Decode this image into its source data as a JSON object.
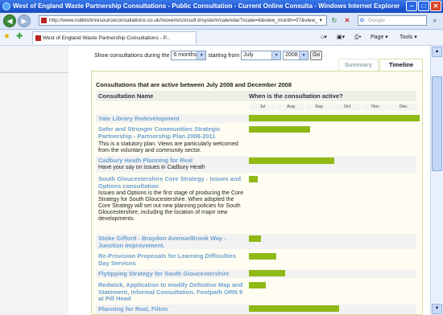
{
  "window": {
    "title": "West of England Waste Partnership Consultations - Public Consultation - Current Online Consulta - Windows Internet Explorer"
  },
  "address": {
    "url": "http://www.rubbishnresourceconsultations.co.uk/inovem/consult.ti/system/calendar?scale=6&view_month=07&view_ ▾",
    "search_placeholder": "Google"
  },
  "tab": {
    "label": "West of England Waste Partnership Consultations - P..."
  },
  "toolbar": {
    "page_label": "Page ▾",
    "tools_label": "Tools ▾"
  },
  "filter": {
    "prefix": "Show consultations during the",
    "period": "6 months",
    "middle": "starting from",
    "month": "July",
    "year": "2008",
    "go_label": "Go"
  },
  "views": {
    "summary": "Summary",
    "timeline": "Timeline"
  },
  "timeline": {
    "caption": "Consultations that are active between July 2008 and December 2008",
    "col_name": "Consultation Name",
    "col_when": "When is the consultation active?",
    "months": [
      "Jul",
      "Aug",
      "Sep",
      "Oct",
      "Nov",
      "Dec"
    ],
    "rows": [
      {
        "name": "Yate Library Redevelopment",
        "desc": ""
      },
      {
        "name": "Safer and Stronger Communities Strategic Partnership - Partnership Plan 2008-2011",
        "desc": "This is a statutory plan. Views are particularly welcomed from the voluntary and community sector."
      },
      {
        "name": "Cadbury Heath Planning for Real",
        "desc": "Have your say on issues in Cadbury Heath"
      },
      {
        "name": "South Gloucestershire Core Strategy - Issues and Options consultation",
        "desc": "Issues and Options is the first stage of producing the Core Strategy for South Gloucestershire. When adopted the Core Strategy will set out new planning policies for South Gloucestershire, including the location of major new developments."
      },
      {
        "name": "Stoke Gifford - Braydon Avenue/Brook Way - Junction Improvement.",
        "desc": ""
      },
      {
        "name": "Re-Provision Proposals for Learning Difficulties Day Services",
        "desc": ""
      },
      {
        "name": "Flytipping Strategy for South Gloucestershire",
        "desc": ""
      },
      {
        "name": "Redwick, Application to modify Definitive Map and Statement, Informal Consultation, Footpath ORN 9 at Pill Head",
        "desc": ""
      },
      {
        "name": "Planning for Real, Filton",
        "desc": ""
      }
    ]
  }
}
